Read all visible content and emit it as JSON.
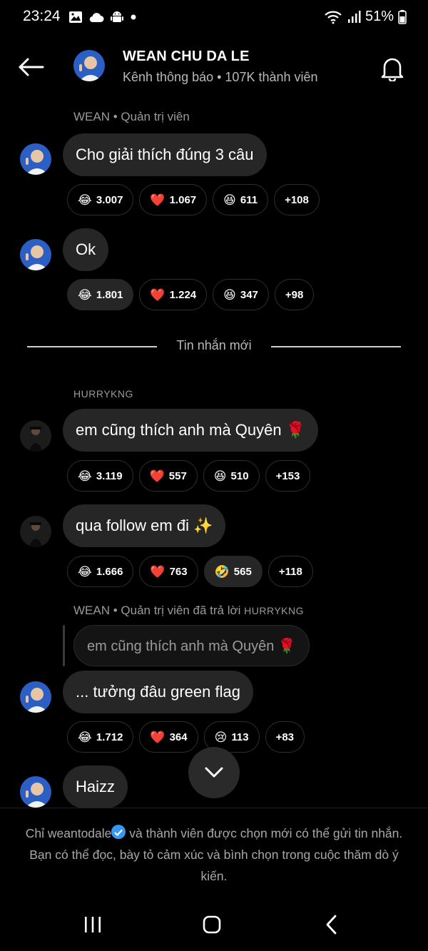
{
  "status_bar": {
    "time": "23:24",
    "battery": "51%"
  },
  "header": {
    "title": "WEAN CHU DA LE",
    "subtitle": "Kênh thông báo • 107K thành viên"
  },
  "messages": [
    {
      "sender": "WEAN • Quản trị viên",
      "text": "Cho giải thích đúng 3 câu",
      "reactions": [
        {
          "emoji": "😂",
          "count": "3.007"
        },
        {
          "emoji": "❤️",
          "count": "1.067"
        },
        {
          "emoji": "😆",
          "count": "611"
        },
        {
          "more": "+108"
        }
      ]
    },
    {
      "text": "Ok",
      "reactions": [
        {
          "emoji": "😂",
          "count": "1.801"
        },
        {
          "emoji": "❤️",
          "count": "1.224"
        },
        {
          "emoji": "😆",
          "count": "347"
        },
        {
          "more": "+98"
        }
      ]
    },
    {
      "sender": "HURRYKNG",
      "text": "em cũng thích anh mà Quyên 🌹",
      "reactions": [
        {
          "emoji": "😂",
          "count": "3.119"
        },
        {
          "emoji": "❤️",
          "count": "557"
        },
        {
          "emoji": "😆",
          "count": "510"
        },
        {
          "more": "+153"
        }
      ]
    },
    {
      "text": "qua follow em đi ✨",
      "reactions": [
        {
          "emoji": "😂",
          "count": "1.666"
        },
        {
          "emoji": "❤️",
          "count": "763"
        },
        {
          "emoji": "🤣",
          "count": "565"
        },
        {
          "more": "+118"
        }
      ]
    },
    {
      "sender_prefix": "WEAN • Quản trị viên đã trả lời",
      "sender_reply_to": "HURRYKNG",
      "quote": "em cũng thích anh mà Quyên 🌹",
      "text": "... tưởng đâu green flag",
      "reactions": [
        {
          "emoji": "😂",
          "count": "1.712"
        },
        {
          "emoji": "❤️",
          "count": "364"
        },
        {
          "emoji": "😢",
          "count": "113"
        },
        {
          "more": "+83"
        }
      ]
    },
    {
      "text": "Haizz"
    }
  ],
  "divider": "Tin nhắn mới",
  "footer": {
    "prefix": "Chỉ",
    "username": "weantodale",
    "suffix": "và thành viên được chọn mới có thể gửi tin nhắn. Bạn có thể đọc, bày tỏ cảm xúc và bình chọn trong cuộc thăm dò ý kiến."
  }
}
